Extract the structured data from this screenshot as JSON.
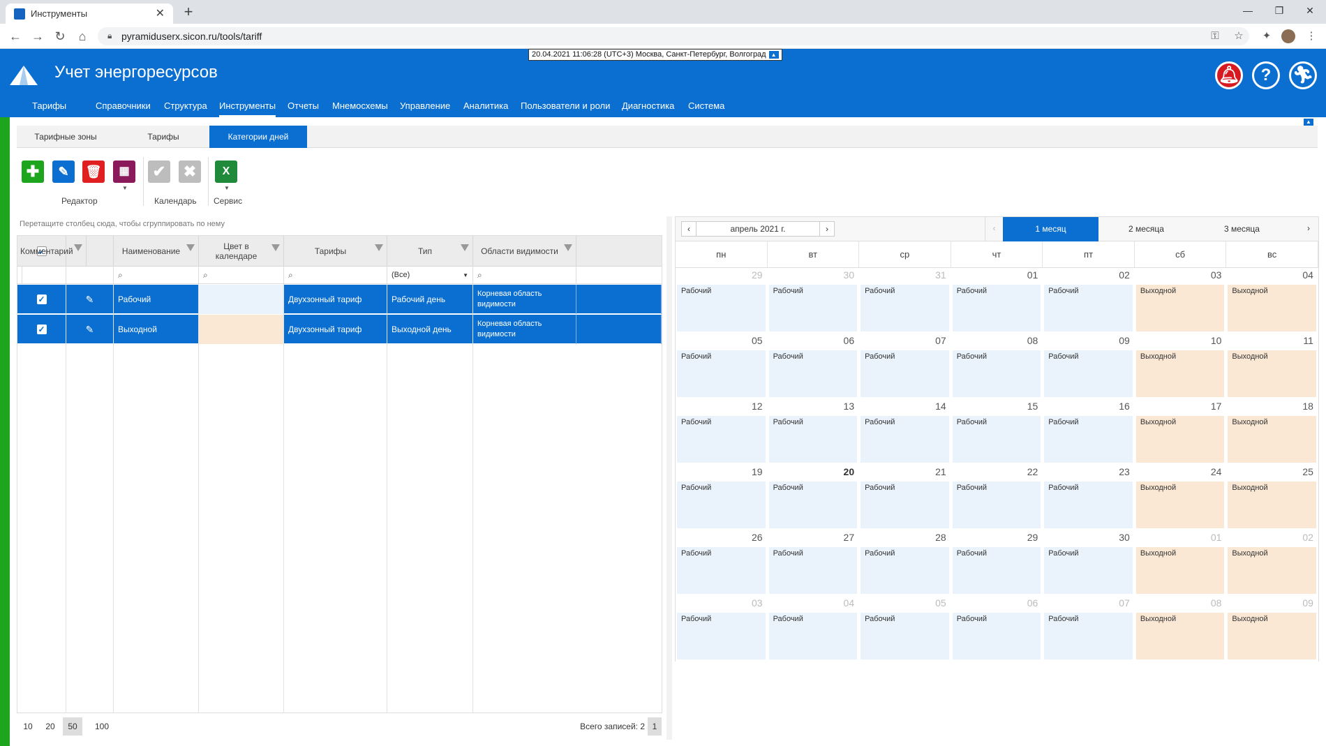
{
  "browser": {
    "tab_title": "Инструменты",
    "url": "pyramiduserx.sicon.ru/tools/tariff"
  },
  "header": {
    "app_title": "Учет энергоресурсов",
    "timestamp": "20.04.2021 11:06:28 (UTC+3) Москва, Санкт-Петербург, Волгоград",
    "menu": [
      "Тарифы",
      "Справочники",
      "Структура",
      "Инструменты",
      "Отчеты",
      "Мнемосхемы",
      "Управление",
      "Аналитика",
      "Пользователи и роли",
      "Диагностика",
      "Система"
    ],
    "active_menu": "Инструменты"
  },
  "subtabs": [
    "Тарифные зоны",
    "Тарифы",
    "Категории дней"
  ],
  "active_subtab": "Категории дней",
  "toolbar": {
    "groups": [
      "Редактор",
      "Календарь",
      "Сервис"
    ]
  },
  "grid": {
    "group_hint": "Перетащите столбец сюда, чтобы сгруппировать по нему",
    "columns": [
      "Наименование",
      "Цвет в календаре",
      "Тарифы",
      "Тип",
      "Области видимости",
      "Комментарий"
    ],
    "type_filter": "(Все)",
    "rows": [
      {
        "name": "Рабочий",
        "color": "#eaf3fc",
        "tariff": "Двухзонный тариф",
        "type": "Рабочий день",
        "scope": "Корневая область видимости",
        "comment": ""
      },
      {
        "name": "Выходной",
        "color": "#fbe8d4",
        "tariff": "Двухзонный тариф",
        "type": "Выходной день",
        "scope": "Корневая область видимости",
        "comment": ""
      }
    ],
    "page_sizes": [
      "10",
      "20",
      "50",
      "100"
    ],
    "active_page_size": "50",
    "total_label": "Всего записей: 2",
    "current_page": "1"
  },
  "calendar": {
    "month_label": "апрель 2021 г.",
    "views": [
      "1 месяц",
      "2 месяца",
      "3 месяца"
    ],
    "active_view": "1 месяц",
    "weekdays": [
      "пн",
      "вт",
      "ср",
      "чт",
      "пт",
      "сб",
      "вс"
    ],
    "weeks": [
      [
        {
          "d": "29",
          "o": true,
          "c": "Рабочий"
        },
        {
          "d": "30",
          "o": true,
          "c": "Рабочий"
        },
        {
          "d": "31",
          "o": true,
          "c": "Рабочий"
        },
        {
          "d": "01",
          "c": "Рабочий"
        },
        {
          "d": "02",
          "c": "Рабочий"
        },
        {
          "d": "03",
          "c": "Выходной"
        },
        {
          "d": "04",
          "c": "Выходной"
        }
      ],
      [
        {
          "d": "05",
          "c": "Рабочий"
        },
        {
          "d": "06",
          "c": "Рабочий"
        },
        {
          "d": "07",
          "c": "Рабочий"
        },
        {
          "d": "08",
          "c": "Рабочий"
        },
        {
          "d": "09",
          "c": "Рабочий"
        },
        {
          "d": "10",
          "c": "Выходной"
        },
        {
          "d": "11",
          "c": "Выходной"
        }
      ],
      [
        {
          "d": "12",
          "c": "Рабочий"
        },
        {
          "d": "13",
          "c": "Рабочий"
        },
        {
          "d": "14",
          "c": "Рабочий"
        },
        {
          "d": "15",
          "c": "Рабочий"
        },
        {
          "d": "16",
          "c": "Рабочий"
        },
        {
          "d": "17",
          "c": "Выходной"
        },
        {
          "d": "18",
          "c": "Выходной"
        }
      ],
      [
        {
          "d": "19",
          "c": "Рабочий"
        },
        {
          "d": "20",
          "t": true,
          "c": "Рабочий"
        },
        {
          "d": "21",
          "c": "Рабочий"
        },
        {
          "d": "22",
          "c": "Рабочий"
        },
        {
          "d": "23",
          "c": "Рабочий"
        },
        {
          "d": "24",
          "c": "Выходной"
        },
        {
          "d": "25",
          "c": "Выходной"
        }
      ],
      [
        {
          "d": "26",
          "c": "Рабочий"
        },
        {
          "d": "27",
          "c": "Рабочий"
        },
        {
          "d": "28",
          "c": "Рабочий"
        },
        {
          "d": "29",
          "c": "Рабочий"
        },
        {
          "d": "30",
          "c": "Рабочий"
        },
        {
          "d": "01",
          "o": true,
          "c": "Выходной"
        },
        {
          "d": "02",
          "o": true,
          "c": "Выходной"
        }
      ],
      [
        {
          "d": "03",
          "o": true,
          "c": "Рабочий"
        },
        {
          "d": "04",
          "o": true,
          "c": "Рабочий"
        },
        {
          "d": "05",
          "o": true,
          "c": "Рабочий"
        },
        {
          "d": "06",
          "o": true,
          "c": "Рабочий"
        },
        {
          "d": "07",
          "o": true,
          "c": "Рабочий"
        },
        {
          "d": "08",
          "o": true,
          "c": "Выходной"
        },
        {
          "d": "09",
          "o": true,
          "c": "Выходной"
        }
      ]
    ]
  }
}
